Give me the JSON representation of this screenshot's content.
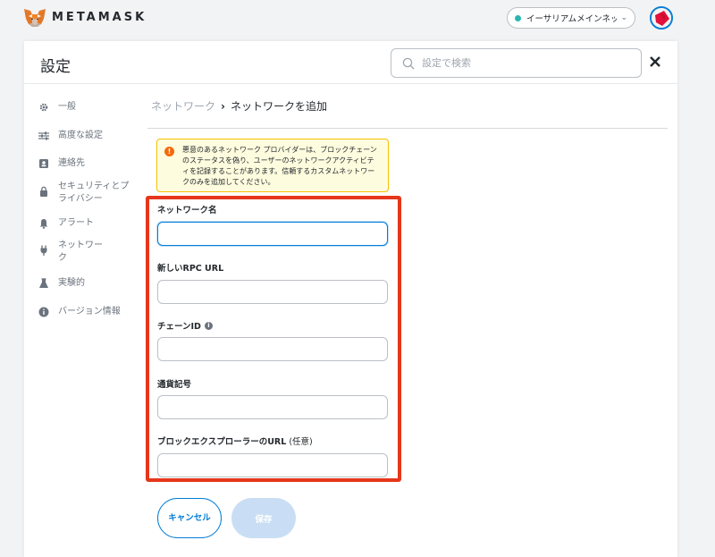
{
  "app": {
    "brand": "METAMASK",
    "network": "イーサリアムメインネット",
    "network_color": "#29b6af",
    "accent": "#037dd6"
  },
  "header": {
    "title": "設定",
    "search_placeholder": "設定で検索"
  },
  "sidebar": {
    "items": [
      {
        "label": "一般",
        "icon": "gear-icon"
      },
      {
        "label": "高度な設定",
        "icon": "sliders-icon"
      },
      {
        "label": "連絡先",
        "icon": "contact-book-icon"
      },
      {
        "label": "セキュリティとプライバシー",
        "icon": "lock-icon"
      },
      {
        "label": "アラート",
        "icon": "bell-icon"
      },
      {
        "label": "ネットワーク",
        "icon": "plug-icon"
      },
      {
        "label": "実験的",
        "icon": "flask-icon"
      },
      {
        "label": "バージョン情報",
        "icon": "info-icon"
      }
    ]
  },
  "breadcrumb": {
    "parent": "ネットワーク",
    "separator": "›",
    "current": "ネットワークを追加"
  },
  "warning": {
    "text": "悪意のあるネットワーク プロバイダーは、ブロックチェーンのステータスを偽り、ユーザーのネットワークアクティビティを記録することがあります。信頼するカスタムネットワークのみを追加してください。",
    "color": "#f8c000"
  },
  "form": {
    "fields": [
      {
        "label": "ネットワーク名",
        "value": ""
      },
      {
        "label": "新しいRPC URL",
        "value": ""
      },
      {
        "label": "チェーンID",
        "value": ""
      },
      {
        "label": "通貨記号",
        "value": ""
      },
      {
        "label": "ブロックエクスプローラーのURL",
        "optional": "(任意)",
        "value": ""
      }
    ],
    "cancel_label": "キャンセル",
    "save_label": "保存",
    "highlight_color": "#e6361b"
  }
}
